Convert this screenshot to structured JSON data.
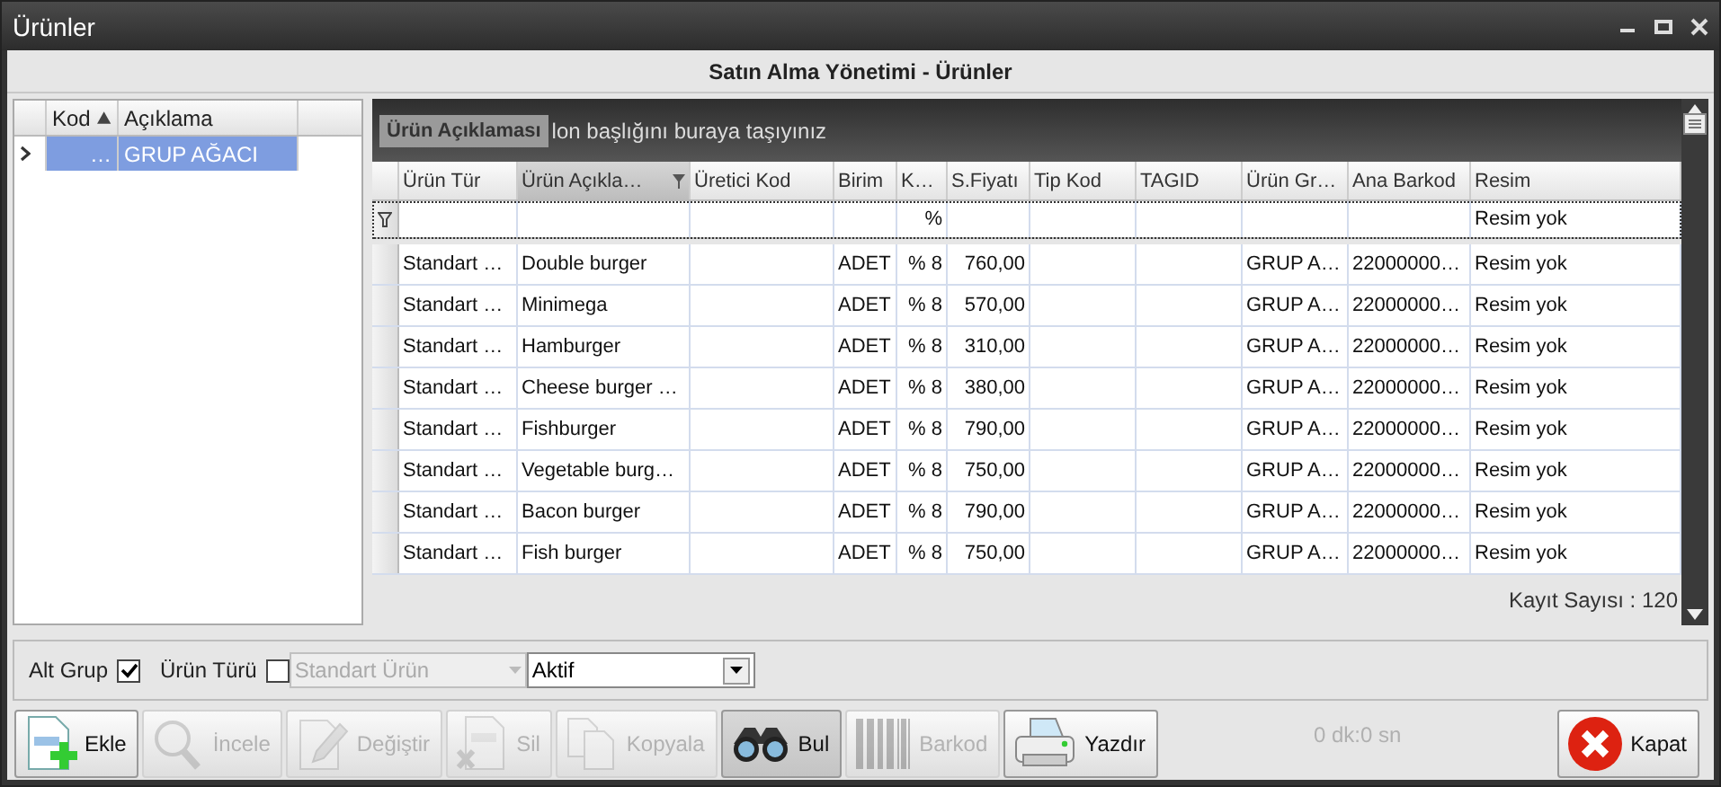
{
  "window": {
    "title": "Ürünler"
  },
  "heading": "Satın Alma Yönetimi - Ürünler",
  "tree_grid": {
    "columns": [
      {
        "label": "Kod",
        "sorted": true
      },
      {
        "label": "Açıklama",
        "sorted": false
      }
    ],
    "rows": [
      {
        "selected": true,
        "cells": [
          "…",
          "GRUP AĞACI"
        ]
      }
    ]
  },
  "grid": {
    "group_hint": "lon başlığını buraya taşıyınız",
    "dragged_header": "Ürün Açıklaması",
    "columns": [
      {
        "label": "Ürün Tür",
        "filtered": false
      },
      {
        "label": "Ürün Açıkla…",
        "filtered": true
      },
      {
        "label": "Üretici Kod",
        "filtered": false
      },
      {
        "label": "Birim",
        "filtered": false
      },
      {
        "label": "K…",
        "filtered": false,
        "filter": "%"
      },
      {
        "label": "S.Fiyatı",
        "filtered": false
      },
      {
        "label": "Tip Kod",
        "filtered": false
      },
      {
        "label": "TAGID",
        "filtered": false
      },
      {
        "label": "Ürün Gr…",
        "filtered": false
      },
      {
        "label": "Ana Barkod",
        "filtered": false
      },
      {
        "label": "Resim",
        "filtered": false,
        "filter": "Resim yok"
      }
    ],
    "rows": [
      {
        "cells": [
          "Standart …",
          "Double burger",
          "",
          "ADET",
          "% 8",
          "760,00",
          "",
          "",
          "GRUP A…",
          "22000000…",
          "Resim yok"
        ]
      },
      {
        "cells": [
          "Standart …",
          "Minimega",
          "",
          "ADET",
          "% 8",
          "570,00",
          "",
          "",
          "GRUP A…",
          "22000000…",
          "Resim yok"
        ]
      },
      {
        "cells": [
          "Standart …",
          "Hamburger",
          "",
          "ADET",
          "% 8",
          "310,00",
          "",
          "",
          "GRUP A…",
          "22000000…",
          "Resim yok"
        ]
      },
      {
        "cells": [
          "Standart …",
          "Cheese burger …",
          "",
          "ADET",
          "% 8",
          "380,00",
          "",
          "",
          "GRUP A…",
          "22000000…",
          "Resim yok"
        ]
      },
      {
        "cells": [
          "Standart …",
          "Fishburger",
          "",
          "ADET",
          "% 8",
          "790,00",
          "",
          "",
          "GRUP A…",
          "22000000…",
          "Resim yok"
        ]
      },
      {
        "cells": [
          "Standart …",
          "Vegetable burg…",
          "",
          "ADET",
          "% 8",
          "750,00",
          "",
          "",
          "GRUP A…",
          "22000000…",
          "Resim yok"
        ]
      },
      {
        "cells": [
          "Standart …",
          "Bacon burger",
          "",
          "ADET",
          "% 8",
          "790,00",
          "",
          "",
          "GRUP A…",
          "22000000…",
          "Resim yok"
        ]
      },
      {
        "cells": [
          "Standart …",
          "Fish burger",
          "",
          "ADET",
          "% 8",
          "750,00",
          "",
          "",
          "GRUP A…",
          "22000000…",
          "Resim yok"
        ]
      }
    ],
    "record_count": "Kayıt Sayısı : 120"
  },
  "filters": {
    "alt_grup": {
      "label": "Alt Grup",
      "checked": true
    },
    "urun_turu": {
      "label": "Ürün Türü",
      "checked": false
    },
    "type_combo": {
      "value": "Standart Ürün",
      "disabled": true
    },
    "status_combo": {
      "value": "Aktif",
      "disabled": false
    }
  },
  "buttons": [
    {
      "kind": "add",
      "label": "Ekle",
      "disabled": false
    },
    {
      "kind": "view",
      "label": "İncele",
      "disabled": true
    },
    {
      "kind": "edit",
      "label": "Değiştir",
      "disabled": true
    },
    {
      "kind": "delete",
      "label": "Sil",
      "disabled": true
    },
    {
      "kind": "copy",
      "label": "Kopyala",
      "disabled": true
    },
    {
      "kind": "find",
      "label": "Bul",
      "disabled": false
    },
    {
      "kind": "barcode",
      "label": "Barkod",
      "disabled": true
    },
    {
      "kind": "print",
      "label": "Yazdır",
      "disabled": false
    }
  ],
  "timer": "0 dk:0 sn",
  "close_button": {
    "label": "Kapat"
  }
}
